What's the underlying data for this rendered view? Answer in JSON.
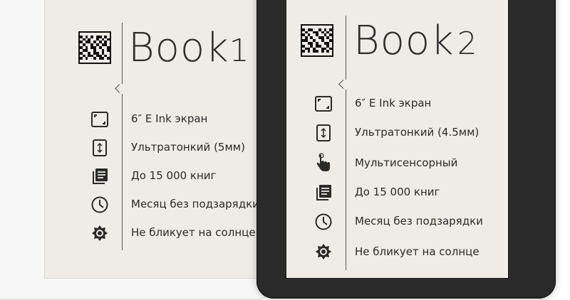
{
  "device1": {
    "title_base": "Book",
    "title_num": "1",
    "features": [
      {
        "icon": "screen-corners-icon",
        "label": "6″ E Ink экран"
      },
      {
        "icon": "thin-profile-icon",
        "label": "Ультратонкий (5мм)"
      },
      {
        "icon": "book-stack-icon",
        "label": "До 15 000 книг"
      },
      {
        "icon": "clock-icon",
        "label": "Месяц без подзарядки"
      },
      {
        "icon": "sun-gear-icon",
        "label": "Не бликует на солнце"
      }
    ]
  },
  "device2": {
    "title_base": "Book",
    "title_num": "2",
    "features": [
      {
        "icon": "screen-corners-icon",
        "label": "6″ E Ink экран"
      },
      {
        "icon": "thin-profile-icon",
        "label": "Ультратонкий (4.5мм)"
      },
      {
        "icon": "touch-hand-icon",
        "label": "Мультисенсорный"
      },
      {
        "icon": "book-stack-icon",
        "label": "До 15 000 книг"
      },
      {
        "icon": "clock-icon",
        "label": "Месяц без подзарядки"
      },
      {
        "icon": "sun-gear-icon",
        "label": "Не бликует на солнце"
      }
    ]
  },
  "colors": {
    "screen": "#efece7",
    "ink": "#2a2a2a",
    "bezel_white": "#f7f7f7",
    "bezel_black": "#2a2a2a"
  }
}
